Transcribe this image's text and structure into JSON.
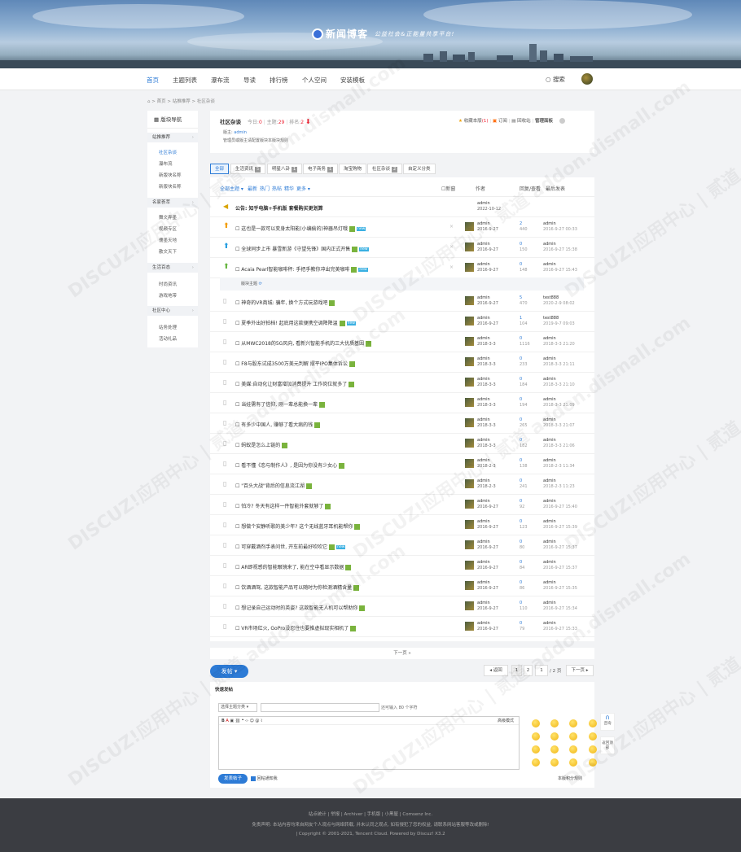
{
  "brand": {
    "name": "新闻博客",
    "slogan": "公益社会&正能量共享平台!"
  },
  "nav": {
    "items": [
      "首页",
      "主题列表",
      "瀑布流",
      "导读",
      "排行榜",
      "个人空间",
      "安装模板"
    ],
    "search": "搜索"
  },
  "breadcrumb": {
    "home": "首页",
    "level1": "站推推荐",
    "level2": "社区杂谈",
    "sep": ">"
  },
  "sidebar": {
    "title": "版块导航",
    "groups": [
      {
        "label": "站推推荐",
        "items": [
          "社区杂谈",
          "瀑布流",
          "新版块名称",
          "新版块名称"
        ]
      },
      {
        "label": "名家荟萃",
        "items": [
          "舞文弄墨",
          "视频专区",
          "儒墨天地",
          "散文天下"
        ]
      },
      {
        "label": "生活百态",
        "items": [
          "时尚资讯",
          "游戏地带"
        ]
      },
      {
        "label": "社区中心",
        "items": [
          "站务处理",
          "活动礼品"
        ]
      }
    ]
  },
  "forum": {
    "name": "社区杂谈",
    "today_label": "今日:",
    "today": "0",
    "topics_label": "主题:",
    "topics": "29",
    "rank_label": "排名:",
    "rank": "2",
    "moderator_label": "版主:",
    "moderator": "admin",
    "desc": "管理员或版主请配置版块本版块规则",
    "fav": "收藏本版",
    "fav_count": "(1)",
    "subscribe": "订阅",
    "home": "回收站",
    "manage": "管理面板"
  },
  "tabs": [
    {
      "label": "全部"
    },
    {
      "label": "生活资讯",
      "count": "5"
    },
    {
      "label": "明星八卦",
      "count": "1"
    },
    {
      "label": "电子商务",
      "count": "1"
    },
    {
      "label": "淘宝购物"
    },
    {
      "label": "社区杂谈",
      "count": "2"
    },
    {
      "label": "自定义分类"
    }
  ],
  "listhead": {
    "all": "全部主题",
    "filters": [
      "最新",
      "热门",
      "热帖",
      "精华",
      "更多"
    ],
    "newwin": "新窗",
    "author": "作者",
    "replies": "回复/查看",
    "last": "最后发表"
  },
  "announce": {
    "prefix": "公告:",
    "title": "知乎电脑+手机版 套餐购买更划算",
    "author": "admin",
    "date": "2022-10-12"
  },
  "sticky": [
    {
      "title": "这也是一款可以变身太阳能(小编偷的)神器吊灯哦",
      "author": "admin",
      "date": "2016-9-27",
      "replies": "2",
      "views": "440",
      "last_user": "admin",
      "last_time": "2016-9-27 00:33",
      "hasNew": true
    },
    {
      "title": "全球同步上市 暴雪新游《守望先锋》国内正式开售",
      "author": "admin",
      "date": "2016-9-27",
      "replies": "0",
      "views": "150",
      "last_user": "admin",
      "last_time": "2016-9-27 15:38",
      "hasNew": true
    },
    {
      "title": "Acaia Pearl智能咖啡秤: 手把手教你冲出完美咖啡",
      "author": "admin",
      "date": "2016-9-27",
      "replies": "0",
      "views": "148",
      "last_user": "admin",
      "last_time": "2016-9-27 15:43",
      "hasNew": true
    }
  ],
  "section_label": "版块主题",
  "threads": [
    {
      "title": "神奇的VR商城: 骗年, 换个方式玩游戏吧",
      "author": "admin",
      "date": "2016-9-27",
      "replies": "5",
      "views": "470",
      "last_user": "test888",
      "last_time": "2020-2-9 08:02"
    },
    {
      "title": "夏季外出好拍档! 起底用这款便携空调降降温",
      "author": "admin",
      "date": "2016-9-27",
      "replies": "1",
      "views": "104",
      "last_user": "test888",
      "last_time": "2019-9-7 09:03",
      "hasNew": true
    },
    {
      "title": "从MWC2018的5G风向, 看新兴智能手机的三大优质基因",
      "author": "admin",
      "date": "2018-3-3",
      "replies": "0",
      "views": "1116",
      "last_user": "admin",
      "last_time": "2018-3-3 21:20"
    },
    {
      "title": "F8与股东试成3500万美元判解 摆平IPO集体诉讼",
      "author": "admin",
      "date": "2018-3-3",
      "replies": "0",
      "views": "233",
      "last_user": "admin",
      "last_time": "2018-3-3 21:11"
    },
    {
      "title": "美媒:自动化让财富增加消费提升 工作岗位就多了",
      "author": "admin",
      "date": "2018-3-3",
      "replies": "0",
      "views": "184",
      "last_user": "admin",
      "last_time": "2018-3-3 21:10"
    },
    {
      "title": "当娃需有了信仰, 刚一辈总能换一辈",
      "author": "admin",
      "date": "2018-3-3",
      "replies": "0",
      "views": "194",
      "last_user": "admin",
      "last_time": "2018-3-3 21:09"
    },
    {
      "title": "有多少中国人, 赚够了看大病的钱",
      "author": "admin",
      "date": "2018-3-3",
      "replies": "0",
      "views": "265",
      "last_user": "admin",
      "last_time": "2018-3-3 21:07"
    },
    {
      "title": "蚂蚁是怎么上链的",
      "author": "admin",
      "date": "2018-3-3",
      "replies": "0",
      "views": "182",
      "last_user": "admin",
      "last_time": "2018-3-3 21:06"
    },
    {
      "title": "看不懂《恋与制作人》, 是因为你没有少女心",
      "author": "admin",
      "date": "2018-2-3",
      "replies": "0",
      "views": "138",
      "last_user": "admin",
      "last_time": "2018-2-3 11:34"
    },
    {
      "title": "\"百头大战\"背后的信息流江湖",
      "author": "admin",
      "date": "2018-2-3",
      "replies": "0",
      "views": "241",
      "last_user": "admin",
      "last_time": "2018-2-3 11:23"
    },
    {
      "title": "怕冷? 冬天有这样一件智能外套就够了",
      "author": "admin",
      "date": "2016-9-27",
      "replies": "0",
      "views": "92",
      "last_user": "admin",
      "last_time": "2016-9-27 15:40"
    },
    {
      "title": "想做个安静听歌的美少年? 这个无线蓝牙耳机能帮你",
      "author": "admin",
      "date": "2016-9-27",
      "replies": "0",
      "views": "123",
      "last_user": "admin",
      "last_time": "2016-9-27 15:39"
    },
    {
      "title": "可穿戴酒剂手表问世, 开车前最好吹吹它",
      "author": "admin",
      "date": "2016-9-27",
      "replies": "0",
      "views": "80",
      "last_user": "admin",
      "last_time": "2016-9-27 15:37",
      "hasNew": true
    },
    {
      "title": "AR即视感的智能眼镜来了, 能在空中看显示数据",
      "author": "admin",
      "date": "2016-9-27",
      "replies": "0",
      "views": "84",
      "last_user": "admin",
      "last_time": "2016-9-27 15:37"
    },
    {
      "title": "饮酒酒驾, 这款智能产品可以随时为你检测酒精含量",
      "author": "admin",
      "date": "2016-9-27",
      "replies": "0",
      "views": "86",
      "last_user": "admin",
      "last_time": "2016-9-27 15:35"
    },
    {
      "title": "想记录自己运动时的英姿? 这款智能无人机可以帮助你",
      "author": "admin",
      "date": "2016-9-27",
      "replies": "0",
      "views": "110",
      "last_user": "admin",
      "last_time": "2016-9-27 15:34"
    },
    {
      "title": "VR市场红火, GoPro没忍住也要推虚拟现实相机了",
      "author": "admin",
      "date": "2016-9-27",
      "replies": "0",
      "views": "79",
      "last_user": "admin",
      "last_time": "2016-9-27 15:33"
    }
  ],
  "pagination": {
    "next": "下一页 »",
    "back": "◂ 返回",
    "p1": "1",
    "p2": "2",
    "input": "1",
    "total": "/ 2 页",
    "nextbtn": "下一页 ▸"
  },
  "post": {
    "button": "发帖 ▾",
    "quick_label": "快速发帖",
    "category": "选择主题分类",
    "maxlen": "还可输入 80 个字符",
    "advanced": "高级模式",
    "submit": "发表帖子",
    "notify": "回帖通知我",
    "rules": "本版积分规则"
  },
  "float": {
    "service": "咨询",
    "top": "返回顶部"
  },
  "footer": {
    "links": "站点统计 | 举报 | Archiver | 手机版 | 小黑屋 | Comsenz Inc.",
    "disclaimer": "免责声明: 本站内容均来自网友个人观点与网络转载, 并未认同之观点, 如有侵犯了您的权益, 请联系网站客服等改或删除!",
    "copyright": "| Copyright © 2001-2021, Tencent Cloud. Powered by Discuz! X3.2"
  },
  "watermark": "DISCUZ!应用中心 | 贰道 addon.dismall.com",
  "colors": {
    "accent": "#2d7bd6",
    "footer": "#3b3d42",
    "badge": "#7ab33d"
  }
}
